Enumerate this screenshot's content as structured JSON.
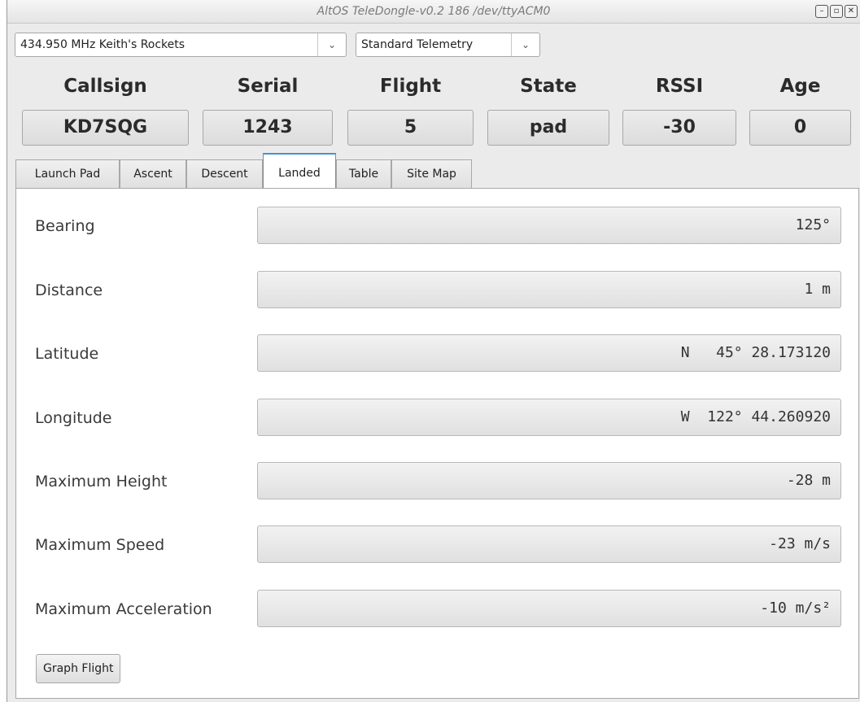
{
  "window": {
    "title": "AltOS TeleDongle-v0.2 186 /dev/ttyACM0"
  },
  "controls": {
    "frequency": "434.950 MHz Keith's Rockets",
    "telemetry": "Standard Telemetry"
  },
  "status": {
    "headers": [
      "Callsign",
      "Serial",
      "Flight",
      "State",
      "RSSI",
      "Age"
    ],
    "values": [
      "KD7SQG",
      "1243",
      "5",
      "pad",
      "-30",
      "0"
    ]
  },
  "tabs": [
    "Launch Pad",
    "Ascent",
    "Descent",
    "Landed",
    "Table",
    "Site Map"
  ],
  "active_tab": "Landed",
  "landed": {
    "rows": [
      {
        "label": "Bearing",
        "value": "125°"
      },
      {
        "label": "Distance",
        "value": "1 m"
      },
      {
        "label": "Latitude",
        "value": "N   45° 28.173120"
      },
      {
        "label": "Longitude",
        "value": "W  122° 44.260920"
      },
      {
        "label": "Maximum Height",
        "value": "-28 m"
      },
      {
        "label": "Maximum Speed",
        "value": "-23 m/s"
      },
      {
        "label": "Maximum Acceleration",
        "value": "-10 m/s²"
      }
    ],
    "graph_button": "Graph Flight"
  },
  "icons": {
    "minimize": "minimize-icon",
    "maximize": "maximize-icon",
    "close": "close-icon",
    "dropdown": "chevron-down-icon"
  }
}
